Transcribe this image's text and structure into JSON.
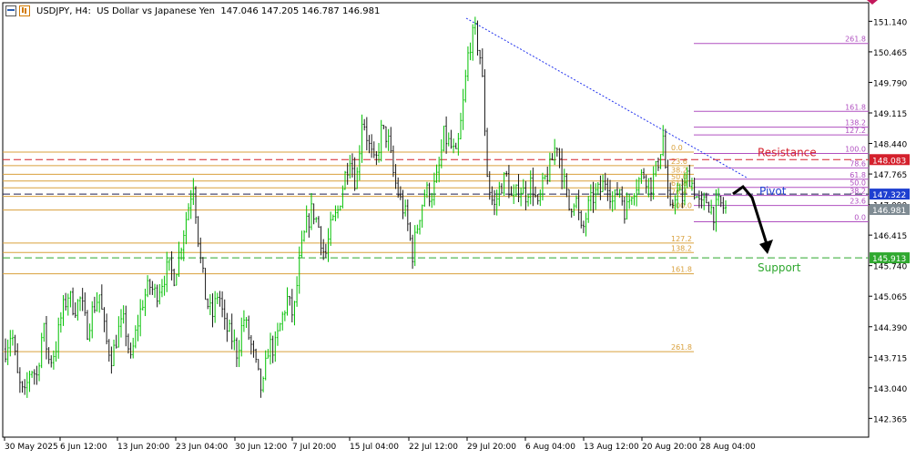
{
  "header": {
    "title": "USDJPY, H4:  US Dollar vs Japanese Yen  147.046 147.205 146.787 146.981"
  },
  "colors": {
    "bull": "#00c000",
    "bear": "#1a1a1a",
    "fib_orange": "#d9a03c",
    "fib_purple": "#b050c0",
    "resistance": "#d4202c",
    "pivot": "#1e3fd0",
    "support": "#2fa82f",
    "trendline": "#2233ee",
    "current_price_tag": "#7f8b93"
  },
  "chart_data": {
    "type": "candlestick",
    "symbol": "USDJPY",
    "timeframe": "H4",
    "ylim": [
      141.95,
      151.55
    ],
    "y_ticks": [
      "151.140",
      "150.465",
      "149.790",
      "149.115",
      "148.440",
      "147.765",
      "147.090",
      "146.415",
      "145.740",
      "145.065",
      "144.390",
      "143.715",
      "143.040",
      "142.365"
    ],
    "x_ticks": [
      "30 May 2025",
      "6 Jun 12:00",
      "13 Jun 20:00",
      "23 Jun 04:00",
      "30 Jun 12:00",
      "7 Jul 20:00",
      "15 Jul 04:00",
      "22 Jul 12:00",
      "29 Jul 20:00",
      "6 Aug 04:00",
      "13 Aug 12:00",
      "20 Aug 20:00",
      "28 Aug 04:00"
    ],
    "close_path": [
      143.9,
      144.3,
      143.2,
      142.8,
      143.5,
      143.3,
      144.4,
      143.6,
      143.9,
      144.7,
      145.1,
      144.8,
      145.0,
      144.3,
      144.8,
      145.1,
      144.1,
      143.7,
      144.3,
      144.5,
      143.6,
      144.4,
      145.0,
      145.3,
      145.1,
      145.4,
      145.7,
      145.5,
      146.2,
      146.9,
      147.6,
      146.0,
      145.0,
      144.6,
      145.2,
      144.4,
      144.2,
      143.8,
      144.6,
      144.1,
      143.5,
      142.9,
      144.0,
      143.9,
      144.5,
      145.0,
      144.6,
      145.9,
      146.6,
      147.0,
      146.6,
      145.9,
      146.6,
      146.9,
      147.6,
      148.2,
      147.5,
      149.1,
      148.4,
      147.9,
      148.7,
      148.6,
      147.7,
      147.2,
      146.8,
      146.0,
      146.8,
      147.4,
      147.3,
      147.7,
      148.6,
      148.4,
      148.1,
      149.2,
      150.6,
      150.9,
      150.2,
      147.6,
      147.0,
      147.5,
      147.7,
      147.1,
      147.5,
      147.3,
      147.6,
      147.0,
      147.6,
      147.9,
      148.5,
      147.7,
      147.0,
      147.3,
      146.4,
      147.0,
      147.3,
      147.4,
      147.7,
      147.1,
      147.5,
      146.9,
      147.4,
      147.6,
      147.8,
      147.5,
      147.9,
      148.6,
      146.8,
      147.4,
      147.2,
      147.8,
      147.4,
      147.0,
      147.2,
      146.9,
      147.1,
      146.981
    ],
    "levels": {
      "resistance": {
        "label": "Resistance",
        "price": 148.083,
        "tag": "148.083"
      },
      "pivot": {
        "label": "Pivot",
        "price": 147.322,
        "tag": "147.322"
      },
      "support": {
        "label": "Support",
        "price": 145.913,
        "tag": "145.913"
      },
      "current": {
        "price": 146.981,
        "tag": "146.981"
      }
    },
    "fib_orange": [
      {
        "label": "0.0",
        "price": 148.25
      },
      {
        "label": "23.6",
        "price": 147.95
      },
      {
        "label": "38.2",
        "price": 147.76
      },
      {
        "label": "50.0",
        "price": 147.61
      },
      {
        "label": "61.8",
        "price": 147.46
      },
      {
        "label": "76.4",
        "price": 147.27
      },
      {
        "label": "100.0",
        "price": 146.97
      },
      {
        "label": "127.2",
        "price": 146.24
      },
      {
        "label": "138.2",
        "price": 146.03
      },
      {
        "label": "161.8",
        "price": 145.56
      },
      {
        "label": "261.8",
        "price": 143.84
      }
    ],
    "fib_purple": [
      {
        "label": "261.8",
        "price": 150.65
      },
      {
        "label": "161.8",
        "price": 149.15
      },
      {
        "label": "138.2",
        "price": 148.8
      },
      {
        "label": "127.2",
        "price": 148.63
      },
      {
        "label": "100.0",
        "price": 148.22
      },
      {
        "label": "78.6",
        "price": 147.9
      },
      {
        "label": "61.8",
        "price": 147.65
      },
      {
        "label": "50.0",
        "price": 147.47
      },
      {
        "label": "38.2",
        "price": 147.29
      },
      {
        "label": "23.6",
        "price": 147.07
      },
      {
        "label": "0.0",
        "price": 146.71
      }
    ]
  }
}
